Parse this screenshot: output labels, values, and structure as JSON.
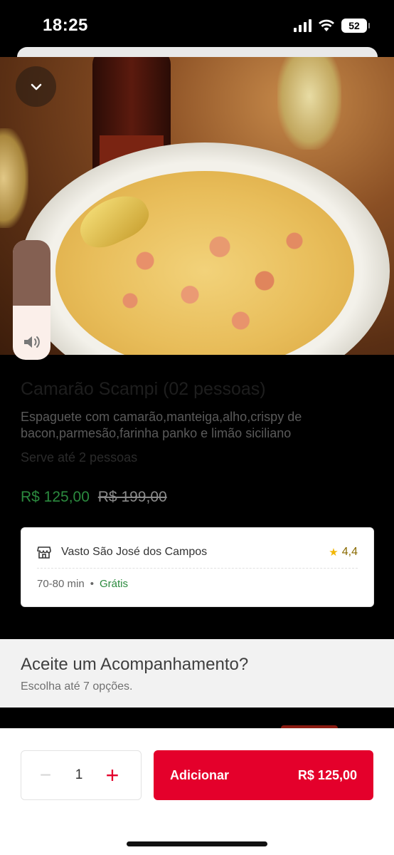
{
  "status_bar": {
    "time": "18:25",
    "battery": "52"
  },
  "hero": {
    "collapse_icon": "chevron-down-icon"
  },
  "volume_hud": {
    "level": 0.45,
    "icon": "speaker-icon"
  },
  "product": {
    "title": "Camarão Scampi (02 pessoas)",
    "description": "Espaguete com camarão,manteiga,alho,crispy de bacon,parmesão,farinha panko e limão siciliano",
    "serves": "Serve até 2 pessoas",
    "price": "R$ 125,00",
    "original_price": "R$ 199,00"
  },
  "store": {
    "icon": "store-icon",
    "name": "Vasto São José dos Campos",
    "rating": "4,4",
    "delivery_time": "70-80 min",
    "separator": "•",
    "delivery_fee": "Grátis"
  },
  "section": {
    "title": "Aceite um Acompanhamento?",
    "subtitle": "Escolha até 7 opções."
  },
  "footer": {
    "quantity": "1",
    "minus": "−",
    "plus": "+",
    "add_label": "Adicionar",
    "add_price": "R$ 125,00"
  },
  "colors": {
    "accent": "#e4002b",
    "price_green": "#2b8a3e",
    "rating": "#8a6a00"
  }
}
